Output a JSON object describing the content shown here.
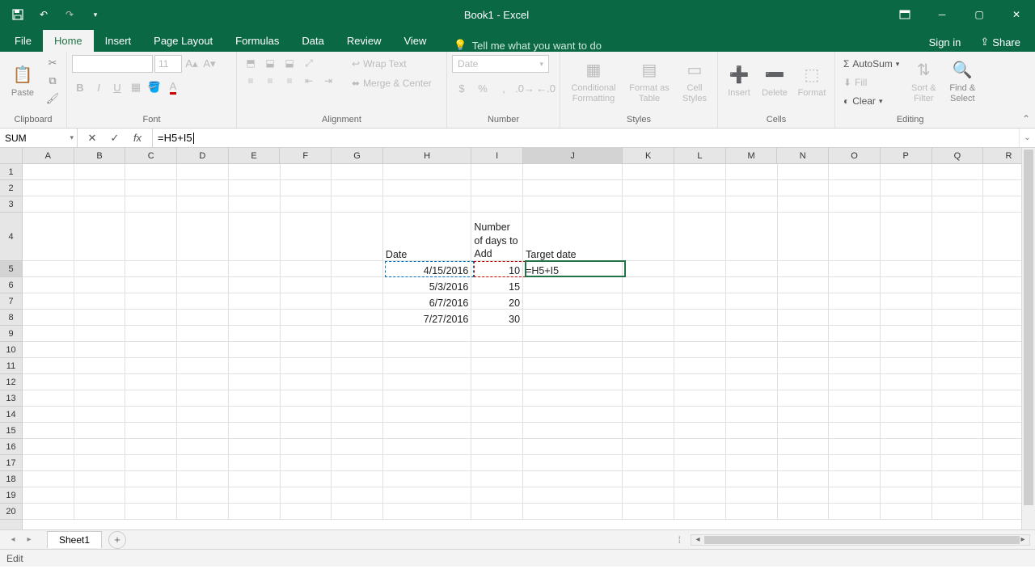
{
  "title": "Book1 - Excel",
  "qat": {
    "save": "💾",
    "undo": "↶",
    "redo": "↷"
  },
  "tabs": {
    "file": "File",
    "home": "Home",
    "insert": "Insert",
    "page_layout": "Page Layout",
    "formulas": "Formulas",
    "data": "Data",
    "review": "Review",
    "view": "View",
    "tell_me": "Tell me what you want to do",
    "sign_in": "Sign in",
    "share": "Share"
  },
  "ribbon": {
    "clipboard": {
      "label": "Clipboard",
      "paste": "Paste"
    },
    "font": {
      "label": "Font",
      "name": "",
      "size": "11"
    },
    "alignment": {
      "label": "Alignment",
      "wrap": "Wrap Text",
      "merge": "Merge & Center"
    },
    "number": {
      "label": "Number",
      "format": "Date"
    },
    "styles": {
      "label": "Styles",
      "conditional": "Conditional\nFormatting",
      "format_as": "Format as\nTable",
      "cell": "Cell\nStyles"
    },
    "cells": {
      "label": "Cells",
      "insert": "Insert",
      "delete": "Delete",
      "format": "Format"
    },
    "editing": {
      "label": "Editing",
      "autosum": "AutoSum",
      "fill": "Fill",
      "clear": "Clear",
      "sort": "Sort &\nFilter",
      "find": "Find &\nSelect"
    }
  },
  "name_box": "SUM",
  "formula_bar": "=H5+I5",
  "columns": [
    "A",
    "B",
    "C",
    "D",
    "E",
    "F",
    "G",
    "H",
    "I",
    "J",
    "K",
    "L",
    "M",
    "N",
    "O",
    "P",
    "Q",
    "R"
  ],
  "rows": [
    "1",
    "2",
    "3",
    "4",
    "5",
    "6",
    "7",
    "8",
    "9",
    "10",
    "11",
    "12",
    "13",
    "14",
    "15",
    "16",
    "17",
    "18",
    "19",
    "20"
  ],
  "sheet": {
    "headers": {
      "H4": "Date",
      "I4": "Number of days to Add",
      "J4": "Target date"
    },
    "data": {
      "H5": "4/15/2016",
      "I5": "10",
      "J5": "=H5+I5",
      "H6": "5/3/2016",
      "I6": "15",
      "H7": "6/7/2016",
      "I7": "20",
      "H8": "7/27/2016",
      "I8": "30"
    }
  },
  "sheet_tab": "Sheet1",
  "status": "Edit"
}
